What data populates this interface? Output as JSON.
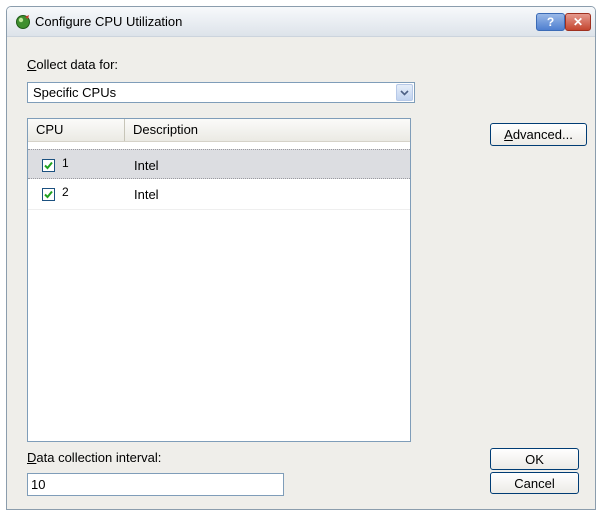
{
  "window": {
    "title": "Configure CPU Utilization",
    "help_label": "?",
    "close_label": "✕"
  },
  "collect": {
    "label": "Collect data for:",
    "selected": "Specific CPUs"
  },
  "list": {
    "columns": [
      "CPU",
      "Description"
    ],
    "rows": [
      {
        "cpu": "1",
        "description": "Intel",
        "checked": true,
        "highlighted": true
      },
      {
        "cpu": "2",
        "description": "Intel",
        "checked": true,
        "highlighted": false
      }
    ]
  },
  "buttons": {
    "advanced": "Advanced...",
    "ok": "OK",
    "cancel": "Cancel"
  },
  "interval": {
    "label": "Data collection interval:",
    "value": "10"
  },
  "colors": {
    "dialog_bg": "#efeeea",
    "selected_row": "#dcdde1",
    "checkmark": "#21a121"
  }
}
